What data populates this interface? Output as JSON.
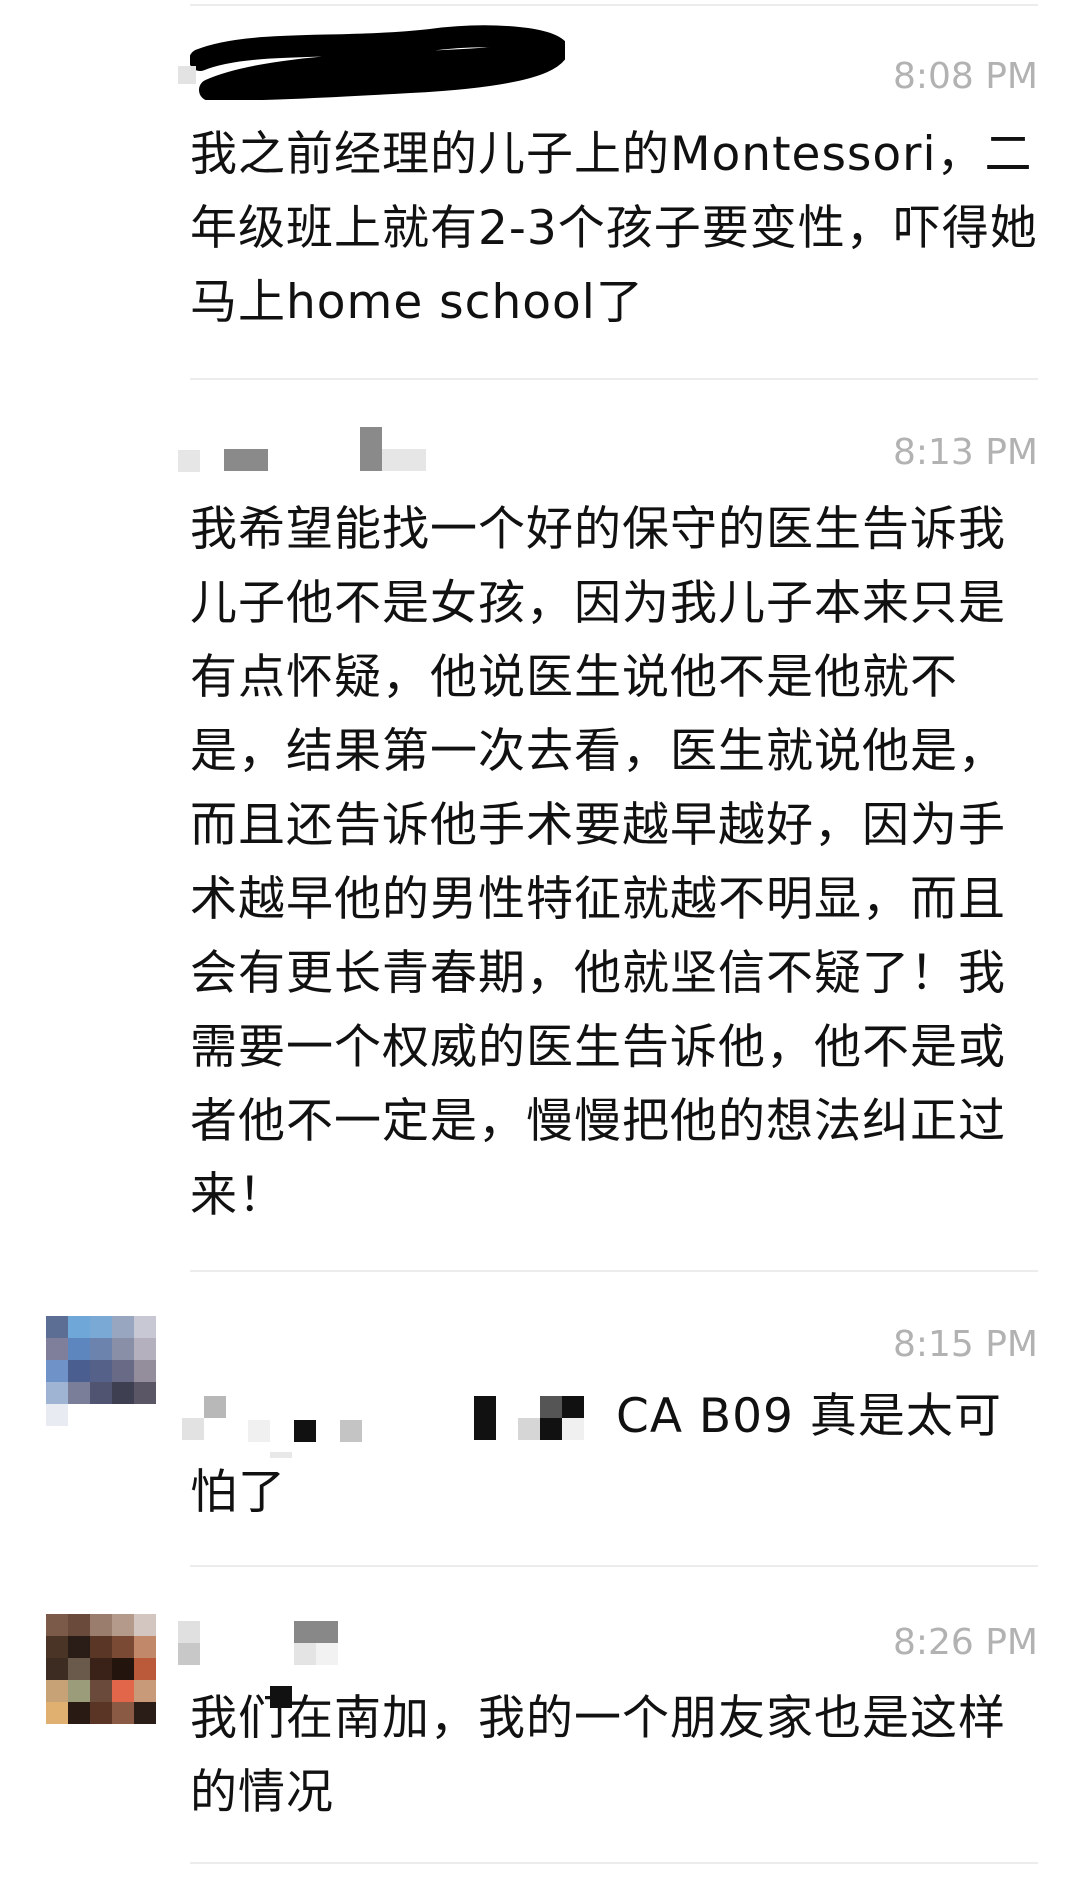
{
  "messages": [
    {
      "time": "8:08 PM",
      "text": "我之前经理的儿子上的Montessori，二年级班上就有2-3个孩子要变性，吓得她马上home school了"
    },
    {
      "time": "8:13 PM",
      "text": "我希望能找一个好的保守的医生告诉我儿子他不是女孩，因为我儿子本来只是有点怀疑，他说医生说他不是他就不是，结果第一次去看，医生就说他是，而且还告诉他手术要越早越好，因为手术越早他的男性特征就越不明显，而且会有更长青春期，他就坚信不疑了！我需要一个权威的医生告诉他，他不是或者他不一定是，慢慢把他的想法纠正过来！"
    },
    {
      "time": "8:15 PM",
      "text_visible": "CA B09 真是太可",
      "text_continued": "怕了"
    },
    {
      "time": "8:26 PM",
      "text": "我们在南加，我的一个朋友家也是这样的情况"
    }
  ],
  "colors": {
    "background": "#ffffff",
    "text": "#111111",
    "timestamp": "#b2b2b2",
    "divider": "#ececec",
    "redaction": "#000000"
  },
  "icons": [
    "avatar-blurred",
    "avatar-blurred-2",
    "name-redaction-scribble"
  ]
}
